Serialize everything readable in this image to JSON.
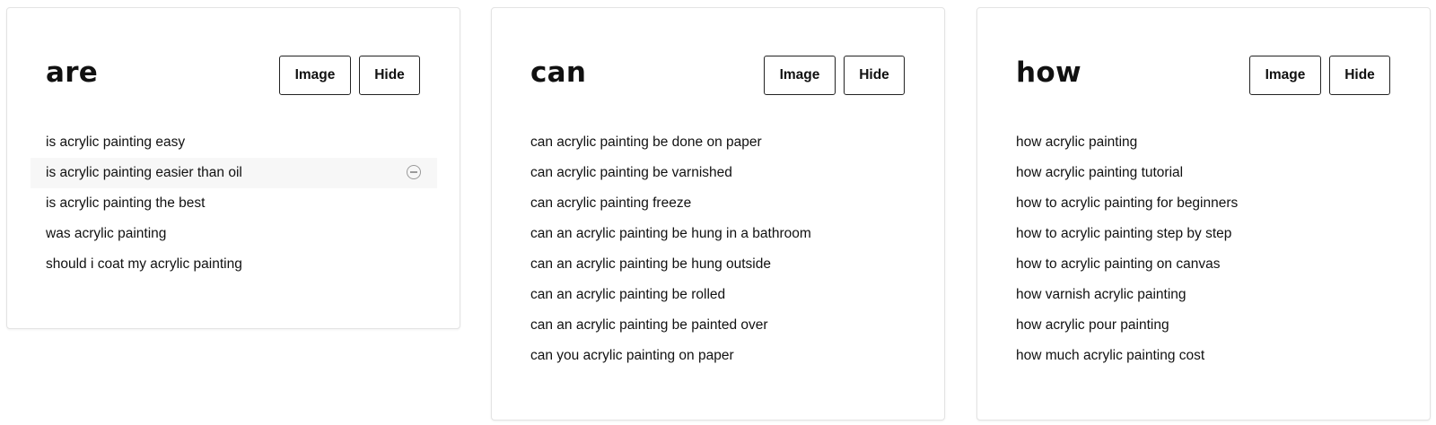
{
  "buttons": {
    "image_label": "Image",
    "hide_label": "Hide"
  },
  "cards": [
    {
      "title": "are",
      "suggestions": [
        "is acrylic painting easy",
        "is acrylic painting easier than oil",
        "is acrylic painting the best",
        "was acrylic painting",
        "should i coat my acrylic painting"
      ]
    },
    {
      "title": "can",
      "suggestions": [
        "can acrylic painting be done on paper",
        "can acrylic painting be varnished",
        "can acrylic painting freeze",
        "can an acrylic painting be hung in a bathroom",
        "can an acrylic painting be hung outside",
        "can an acrylic painting be rolled",
        "can an acrylic painting be painted over",
        "can you acrylic painting on paper"
      ]
    },
    {
      "title": "how",
      "suggestions": [
        "how acrylic painting",
        "how acrylic painting tutorial",
        "how to acrylic painting for beginners",
        "how to acrylic painting step by step",
        "how to acrylic painting on canvas",
        "how varnish acrylic painting",
        "how acrylic pour painting",
        "how much acrylic painting cost"
      ]
    }
  ]
}
